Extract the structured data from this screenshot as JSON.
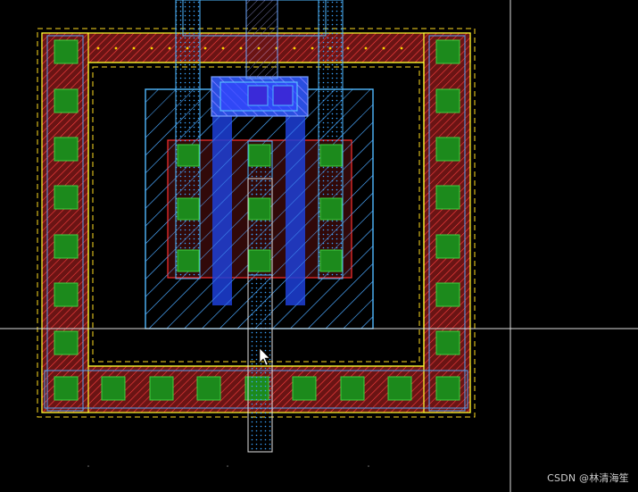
{
  "viewer": {
    "background": "#000000",
    "cursor": "pointer-arrow"
  },
  "layers": {
    "well_pplus": {
      "name": "pplus-guard-ring-diffusion",
      "fill": "#7a1a1a",
      "hatch": "#ff3a3a",
      "dot": "#ffd400",
      "outline": "#ffff30"
    },
    "contact": {
      "name": "contact",
      "fill": "#1c8a1c",
      "outline": "#5cff5c"
    },
    "active": {
      "name": "active",
      "outline": "#50b8ff",
      "hatch": "#50b8ff"
    },
    "nimplant": {
      "name": "implant",
      "outline": "#ff3030",
      "fill": "#5a1010"
    },
    "metal1": {
      "name": "metal1",
      "outline": "#4f9ff0",
      "dots": "#3aa3ff"
    },
    "poly": {
      "name": "poly",
      "fill": "#1d3fd8",
      "hatch": "#8080ff"
    },
    "cursor_line": "#dddddd"
  },
  "watermark": "CSDN @林清海笙"
}
